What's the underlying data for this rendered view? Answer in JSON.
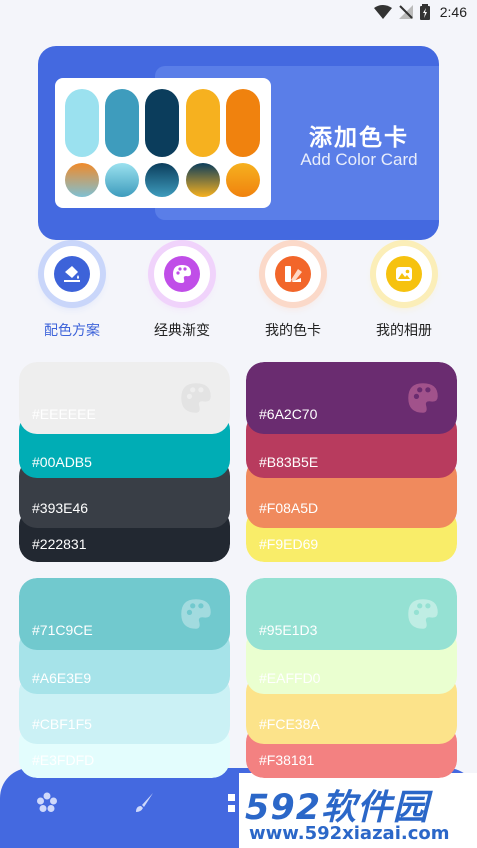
{
  "status_bar": {
    "time": "2:46"
  },
  "banner": {
    "title": "添加色卡",
    "subtitle": "Add Color Card",
    "pill_colors": [
      "#9be1ef",
      "#3e9cbd",
      "#0b3d5c",
      "#f6b11f",
      "#f0820e"
    ],
    "dot_colors": [
      [
        "#f08a2a",
        "#7fc0d2"
      ],
      [
        "#9be1ef",
        "#3e9cbd"
      ],
      [
        "#0b3d5c",
        "#3e9cbd"
      ],
      [
        "#0b3d5c",
        "#f6b11f"
      ],
      [
        "#f6b11f",
        "#f0820e"
      ]
    ]
  },
  "categories": [
    {
      "label": "配色方案",
      "icon": "paint-bucket-icon",
      "color": "#3d63d9",
      "glow": "#c9d6fa",
      "active": true
    },
    {
      "label": "经典渐变",
      "icon": "palette-icon",
      "color": "#c04ee8",
      "glow": "#f0d3fb",
      "active": false
    },
    {
      "label": "我的色卡",
      "icon": "swatch-icon",
      "color": "#f2662a",
      "glow": "#fbd9c9",
      "active": false
    },
    {
      "label": "我的相册",
      "icon": "photo-icon",
      "color": "#f6c20f",
      "glow": "#fbeeb8",
      "active": false
    }
  ],
  "palettes": [
    {
      "colors": [
        "#EEEEEE",
        "#00ADB5",
        "#393E46",
        "#222831"
      ],
      "labels": [
        "#EEEEEE",
        "#00ADB5",
        "#393E46",
        "#222831"
      ]
    },
    {
      "colors": [
        "#6A2C70",
        "#B83B5E",
        "#F08A5D",
        "#F9ED69"
      ],
      "labels": [
        "#6A2C70",
        "#B83B5E",
        "#F08A5D",
        "#F9ED69"
      ]
    },
    {
      "colors": [
        "#71C9CE",
        "#A6E3E9",
        "#CBF1F5",
        "#E3FDFD"
      ],
      "labels": [
        "#71C9CE",
        "#A6E3E9",
        "#CBF1F5",
        "#E3FDFD"
      ]
    },
    {
      "colors": [
        "#95E1D3",
        "#EAFFD0",
        "#FCE38A",
        "#F38181"
      ],
      "labels": [
        "#95E1D3",
        "#EAFFD0",
        "#FCE38A",
        "#F38181"
      ]
    }
  ],
  "bottom_nav": {
    "items": [
      {
        "icon": "flower-icon"
      },
      {
        "icon": "brush-icon"
      },
      {
        "icon": "grid-icon"
      }
    ],
    "color": "#4469e0"
  },
  "watermark": {
    "logo": "592软件园",
    "url": "www.592xiazai.com"
  }
}
